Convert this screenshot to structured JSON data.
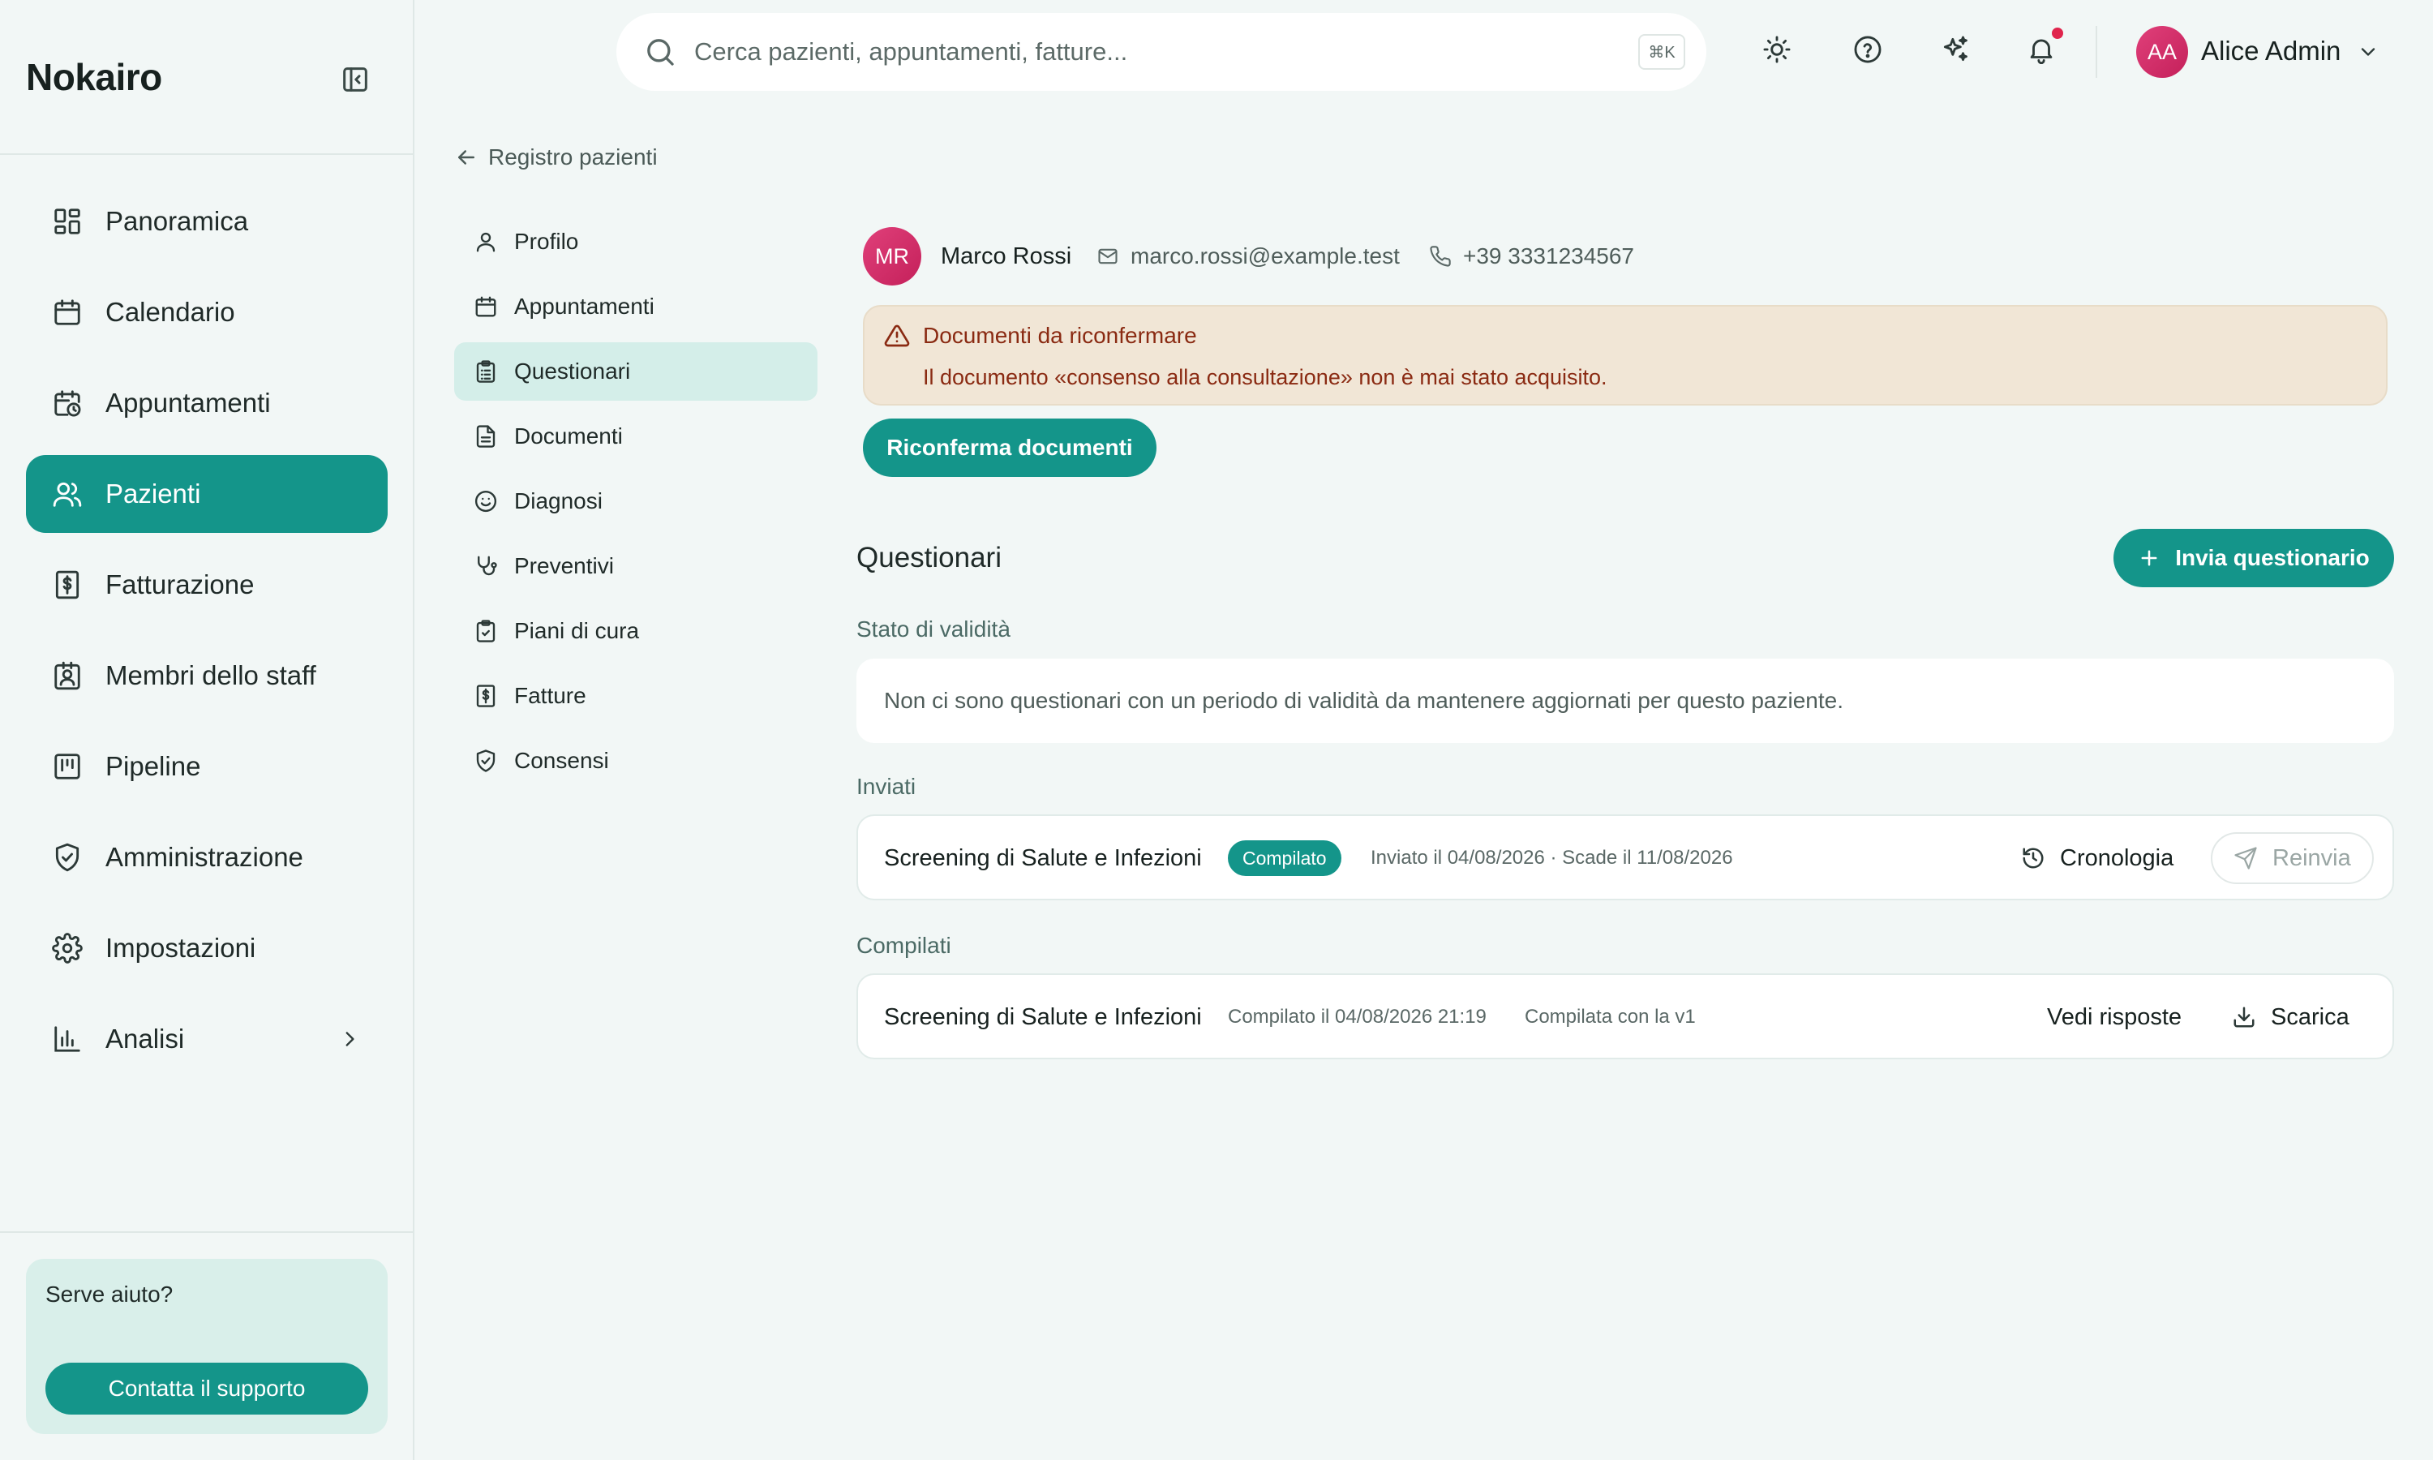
{
  "app": {
    "brand": "Nokairo"
  },
  "sidebar": {
    "items": [
      {
        "label": "Panoramica",
        "icon": "dashboard-icon"
      },
      {
        "label": "Calendario",
        "icon": "calendar-icon"
      },
      {
        "label": "Appuntamenti",
        "icon": "calendar-clock-icon"
      },
      {
        "label": "Pazienti",
        "icon": "users-icon",
        "active": true
      },
      {
        "label": "Fatturazione",
        "icon": "receipt-icon"
      },
      {
        "label": "Membri dello staff",
        "icon": "badge-icon"
      },
      {
        "label": "Pipeline",
        "icon": "kanban-icon"
      },
      {
        "label": "Amministrazione",
        "icon": "shield-check-icon"
      },
      {
        "label": "Impostazioni",
        "icon": "gear-icon"
      },
      {
        "label": "Analisi",
        "icon": "bar-chart-icon",
        "has_chevron": true
      }
    ],
    "help": {
      "title": "Serve aiuto?",
      "button": "Contatta il supporto"
    }
  },
  "header": {
    "search_placeholder": "Cerca pazienti, appuntamenti, fatture...",
    "shortcut": "⌘K",
    "user": {
      "initials": "AA",
      "name": "Alice Admin"
    }
  },
  "breadcrumb": {
    "back_label": "Registro pazienti"
  },
  "subnav": {
    "items": [
      {
        "label": "Profilo",
        "icon": "user-icon"
      },
      {
        "label": "Appuntamenti",
        "icon": "calendar-icon"
      },
      {
        "label": "Questionari",
        "icon": "clipboard-list-icon",
        "active": true
      },
      {
        "label": "Documenti",
        "icon": "file-text-icon"
      },
      {
        "label": "Diagnosi",
        "icon": "smile-icon"
      },
      {
        "label": "Preventivi",
        "icon": "stethoscope-icon"
      },
      {
        "label": "Piani di cura",
        "icon": "clipboard-check-icon"
      },
      {
        "label": "Fatture",
        "icon": "receipt-icon"
      },
      {
        "label": "Consensi",
        "icon": "shield-check-icon"
      }
    ]
  },
  "patient": {
    "initials": "MR",
    "name": "Marco Rossi",
    "email": "marco.rossi@example.test",
    "phone": "+39 3331234567"
  },
  "alert": {
    "title": "Documenti da riconfermare",
    "text": "Il documento «consenso alla consultazione» non è mai stato acquisito.",
    "button": "Riconferma documenti"
  },
  "questionnaires": {
    "title": "Questionari",
    "send_button": "Invia questionario",
    "validity": {
      "label": "Stato di validità",
      "empty_text": "Non ci sono questionari con un periodo di validità da mantenere aggiornati per questo paziente."
    },
    "sent": {
      "label": "Inviati",
      "items": [
        {
          "title": "Screening di Salute e Infezioni",
          "status": "Compilato",
          "meta": "Inviato il 04/08/2026 · Scade il 11/08/2026",
          "history_label": "Cronologia",
          "resend_label": "Reinvia"
        }
      ]
    },
    "completed": {
      "label": "Compilati",
      "items": [
        {
          "title": "Screening di Salute e Infezioni",
          "completed_at": "Compilato il 04/08/2026 21:19",
          "version": "Compilata con la v1",
          "view_label": "Vedi risposte",
          "download_label": "Scarica"
        }
      ]
    }
  },
  "colors": {
    "accent": "#14958a",
    "alert_bg": "#f1e6d6",
    "alert_text": "#8a2a12",
    "avatar": "#d6306a"
  }
}
